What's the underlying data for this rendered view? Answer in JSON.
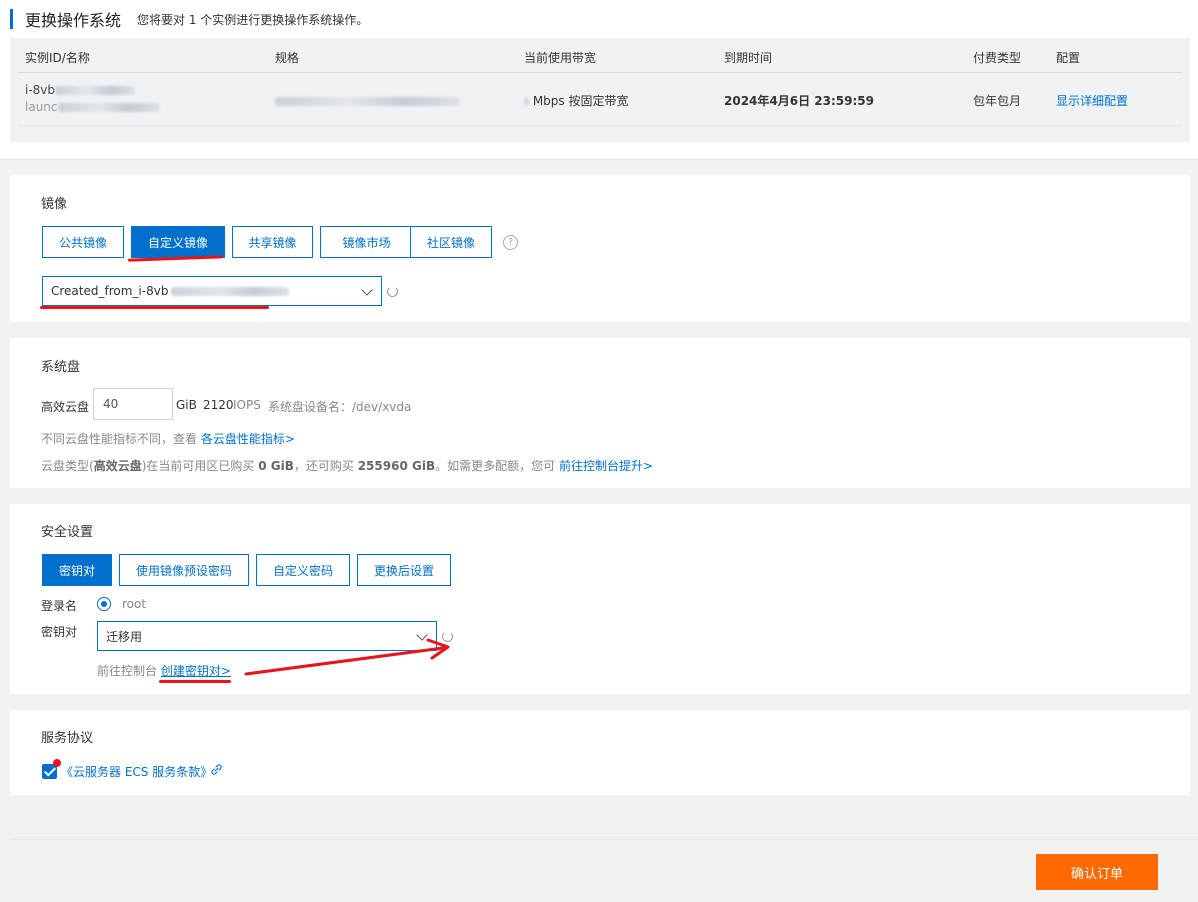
{
  "header": {
    "title": "更换操作系统",
    "subtitle": "您将要对 1 个实例进行更换操作系统操作。"
  },
  "instance_table": {
    "columns": [
      "实例ID/名称",
      "规格",
      "当前使用带宽",
      "到期时间",
      "付费类型",
      "配置"
    ],
    "row": {
      "id_prefix": "i-8vb",
      "name_prefix": "launc",
      "bandwidth": "Mbps 按固定带宽",
      "expire": "2024年4月6日 23:59:59",
      "pay_type": "包年包月",
      "config_link": "显示详细配置"
    }
  },
  "image_section": {
    "title": "镜像",
    "tabs": [
      "公共镜像",
      "自定义镜像",
      "共享镜像",
      "镜像市场",
      "社区镜像"
    ],
    "active_tab": "自定义镜像",
    "selected_image_prefix": "Created_from_i-8vb"
  },
  "disk_section": {
    "title": "系统盘",
    "disk_type": "高效云盘",
    "size_value": "40",
    "unit": "GiB",
    "iops_value": "2120",
    "iops_label": "IOPS",
    "device_name": "系统盘设备名：/dev/xvda",
    "perf_note": "不同云盘性能指标不同，查看",
    "perf_link": "各云盘性能指标>",
    "quota_note_1": "云盘类型(",
    "quota_note_type": "高效云盘",
    "quota_note_2": ")在当前可用区已购买",
    "quota_bought": "0 GiB",
    "quota_note_3": "，还可购买",
    "quota_left": "255960 GiB",
    "quota_note_4": "。如需更多配额，您可",
    "quota_link": "前往控制台提升>"
  },
  "security_section": {
    "title": "安全设置",
    "tabs": [
      "密钥对",
      "使用镜像预设密码",
      "自定义密码",
      "更换后设置"
    ],
    "active_tab": "密钥对",
    "login_label": "登录名",
    "login_value": "root",
    "keypair_label": "密钥对",
    "keypair_value": "迁移用",
    "console_note": "前往控制台",
    "create_link": "创建密钥对>"
  },
  "agreement_section": {
    "title": "服务协议",
    "terms_link": "《云服务器 ECS 服务条款》",
    "checked": true
  },
  "footer": {
    "confirm_label": "确认订单"
  },
  "colors": {
    "primary": "#0070cc",
    "accent_orange": "#ff6a00",
    "annotation_red": "#e8141c"
  }
}
